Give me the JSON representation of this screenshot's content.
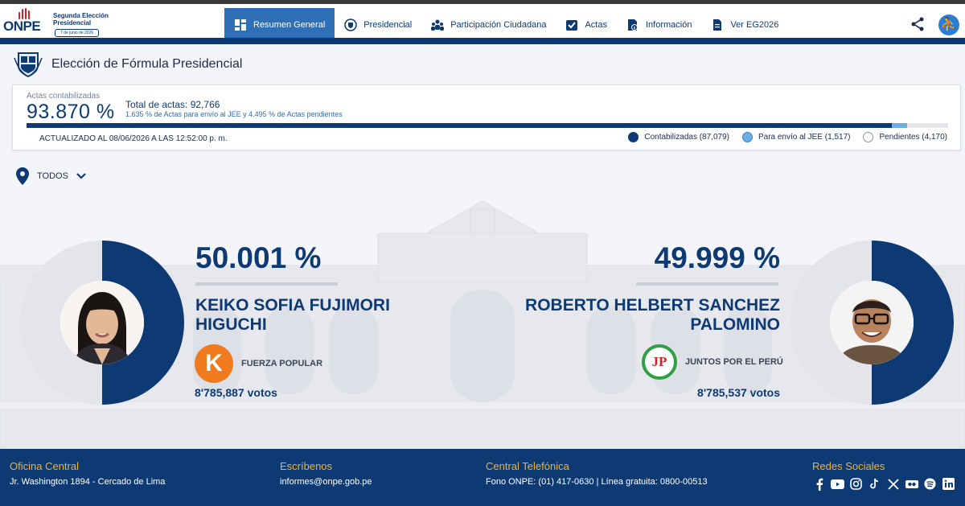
{
  "logo": {
    "brand": "ONPE",
    "title": "Segunda Elección Presidencial",
    "date": "7 de junio de 2026"
  },
  "nav": {
    "items": [
      {
        "label": "Resumen General",
        "icon": "dashboard-icon",
        "active": true
      },
      {
        "label": "Presidencial",
        "icon": "national-shield-icon",
        "active": false
      },
      {
        "label": "Participación Ciudadana",
        "icon": "people-icon",
        "active": false
      },
      {
        "label": "Actas",
        "icon": "checkbox-icon",
        "active": false
      },
      {
        "label": "Información",
        "icon": "info-document-icon",
        "active": false
      },
      {
        "label": "Ver EG2026",
        "icon": "document-icon",
        "active": false
      }
    ]
  },
  "header_icons": {
    "share": "share-icon",
    "accessibility": "accessibility-icon"
  },
  "page": {
    "title": "Elección de Fórmula Presidencial"
  },
  "summary": {
    "label": "Actas contabilizadas",
    "percent": "93.870 %",
    "total": "Total de actas: 92,766",
    "subtext": "1.635 % de Actas para envío al JEE y 4.495 % de Actas pendientes",
    "updated": "ACTUALIZADO AL 08/06/2026 A LAS 12:52:00 p. m.",
    "progress": {
      "counted": 0.9387,
      "jee": 0.01635,
      "pending": 0.04495
    },
    "legend": [
      {
        "label": "Contabilizadas (87,079)",
        "color": "#0e3a73"
      },
      {
        "label": "Para envío al JEE (1,517)",
        "color": "#6aaee8"
      },
      {
        "label": "Pendientes (4,170)",
        "color": "#ffffff"
      }
    ]
  },
  "filter": {
    "label": "TODOS"
  },
  "candidates": [
    {
      "percent": "50.001 %",
      "share": 0.50001,
      "name_line1": "KEIKO SOFIA FUJIMORI",
      "name_line2": "HIGUCHI",
      "party": "FUERZA POPULAR",
      "votes": "8'785,887 votos"
    },
    {
      "percent": "49.999 %",
      "share": 0.49999,
      "name_line1": "ROBERTO HELBERT SANCHEZ",
      "name_line2": "PALOMINO",
      "party": "JUNTOS POR EL PERÚ",
      "votes": "8'785,537 votos"
    }
  ],
  "party_logos": {
    "fuerza": "K",
    "juntos": "JP"
  },
  "footer": {
    "office_title": "Oficina Central",
    "office_text": "Jr. Washington 1894 - Cercado de Lima",
    "write_title": "Escríbenos",
    "write_text": "informes@onpe.gob.pe",
    "phone_title": "Central Telefónica",
    "phone_text": "Fono ONPE: (01) 417-0630 | Línea gratuita: 0800-00513",
    "social_title": "Redes Sociales",
    "socials": [
      "facebook-icon",
      "youtube-icon",
      "instagram-icon",
      "tiktok-icon",
      "x-icon",
      "flickr-icon",
      "spotify-icon",
      "linkedin-icon"
    ]
  },
  "colors": {
    "brand": "#0e3a73",
    "accent": "#2f6fb5",
    "light": "#6aaee8",
    "footer_title": "#f2b233"
  }
}
